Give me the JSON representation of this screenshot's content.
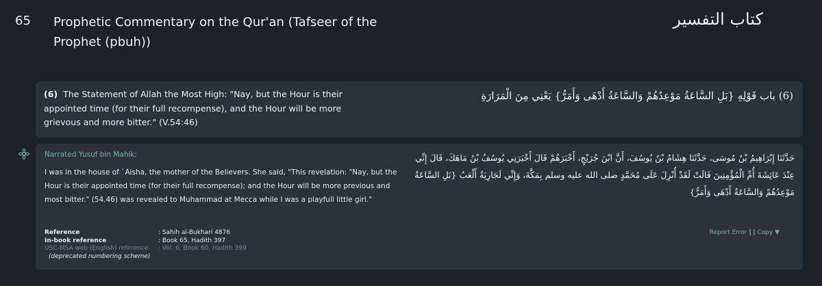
{
  "book": {
    "number": "65",
    "title_en": "Prophetic Commentary on the Qur'an (Tafseer of the Prophet (pbuh))",
    "title_ar": "كتاب التفسير"
  },
  "chapter": {
    "number": "(6)",
    "title_en": "The Statement of Allah the Most High: \"Nay, but the Hour is their appointed time (for their full recompense), and the Hour will be more grievous and more bitter.\" (V.54:46)",
    "title_ar": "(6) باب قَوْلِهِ {بَلِ السَّاعَةُ مَوْعِدُهُمْ وَالسَّاعَةُ أَدْهَى وَأَمَرُّ} يَعْنِي مِنَ الْمَرَارَةِ"
  },
  "hadith": {
    "narrator": "Narrated Yusuf bin Mahik:",
    "text_en": "I was in the house of `Aisha, the mother of the Believers. She said, \"This revelation: \"Nay, but the Hour is their appointed time (for their full recompense); and the Hour will be more previous and most bitter.\" (54.46) was revealed to Muhammad at Mecca while I was a playfull little girl.\"",
    "text_ar": "حَدَّثَنَا إِبْرَاهِيمُ بْنُ مُوسَى، حَدَّثَنَا هِشَامُ بْنُ يُوسُفَ، أَنَّ ابْنَ جُرَيْجٍ، أَخْبَرَهُمْ قَالَ أَخْبَرَنِي يُوسُفُ بْنُ مَاهَكَ، قَالَ إِنِّي عِنْدَ عَائِشَةَ أُمِّ الْمُؤْمِنِينَ قَالَتْ لَقَدْ أُنْزِلَ عَلَى مُحَمَّدٍ صلى الله عليه وسلم بِمَكَّةَ، وَإِنِّي لَجَارِيَةٌ أَلْعَبُ {بَلِ السَّاعَةُ مَوْعِدُهُمْ وَالسَّاعَةُ أَدْهَى وَأَمَرُّ}",
    "references": [
      {
        "label": "Reference",
        "value": ": Sahih al-Bukhari 4876"
      },
      {
        "label": "In-book reference",
        "value": ": Book 65, Hadith 397"
      },
      {
        "label": "USC-MSA web (English) reference",
        "value": ": Vol. 6, Book 60, Hadith 399"
      }
    ],
    "deprecated_note": "(deprecated numbering scheme)",
    "actions": {
      "report_error": "Report Error",
      "separator": "| |",
      "copy": "Copy ▼"
    }
  },
  "icons": {
    "left_side": "flower-icon",
    "right_side": "flower-icon"
  },
  "colors": {
    "background": "#1d2227",
    "panel": "#2b3339",
    "accent": "#7fae9f",
    "text": "#e6e9ec",
    "muted": "#7c858d"
  }
}
